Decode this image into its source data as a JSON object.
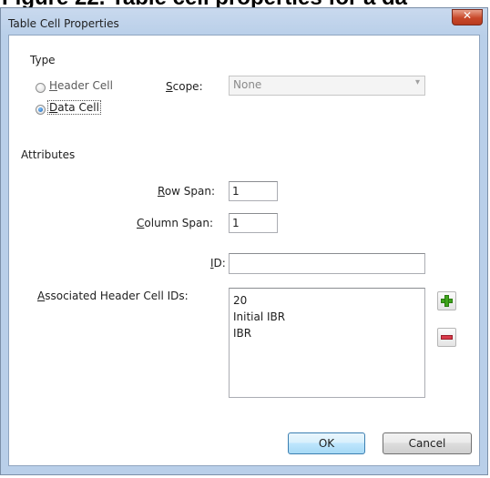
{
  "document": {
    "caption": "Figure 22. Table cell properties for a da"
  },
  "dialog": {
    "title": "Table Cell Properties",
    "close_glyph": "✕"
  },
  "type_section": {
    "heading": "Type",
    "header_cell_label": "Header Cell",
    "data_cell_label": "Data Cell",
    "selected": "Data Cell",
    "scope_label": "Scope:",
    "scope_value": "None",
    "scope_enabled": false
  },
  "attributes_section": {
    "heading": "Attributes",
    "row_span_label": "Row Span:",
    "row_span_value": "1",
    "column_span_label": "Column Span:",
    "column_span_value": "1",
    "id_label": "ID:",
    "id_value": "",
    "associated_label": "Associated Header Cell IDs:",
    "associated_items": [
      "20",
      "Initial IBR",
      "IBR"
    ]
  },
  "buttons": {
    "ok": "OK",
    "cancel": "Cancel"
  },
  "icons": {
    "add": "plus-icon",
    "remove": "minus-icon",
    "add_color": "#3fa51c",
    "remove_color": "#d8394a"
  }
}
